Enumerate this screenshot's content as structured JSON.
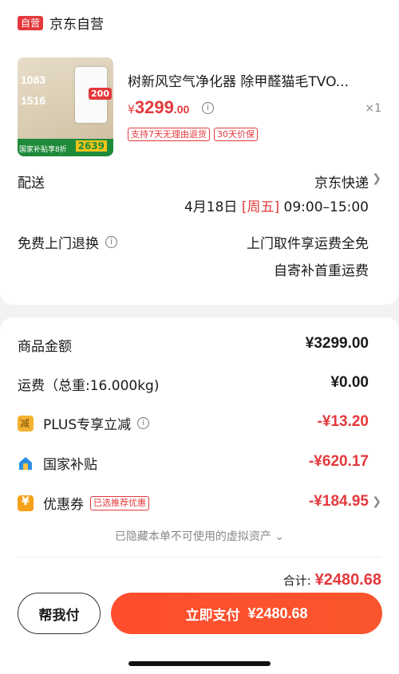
{
  "store": {
    "tag": "自营",
    "name": "京东自营"
  },
  "product": {
    "thumb": {
      "line1": "1083",
      "line2": "1516",
      "badge": "200",
      "bottom_text": "国家补贴享8折",
      "bottom_price": "2639"
    },
    "title": "树新风空气净化器 除甲醛猫毛TVO...",
    "price_yen": "¥",
    "price_int": "3299",
    "price_dec": ".00",
    "quantity": "×1",
    "tags": [
      "支持7天无理由退货",
      "30天价保"
    ]
  },
  "delivery": {
    "label": "配送",
    "carrier": "京东快递",
    "date": "4月18日",
    "weekday": "[周五]",
    "time": "09:00–15:00"
  },
  "return": {
    "label": "免费上门退换",
    "line1": "上门取件享运费全免",
    "line2": "自寄补首重运费"
  },
  "breakdown": {
    "goods_label": "商品金额",
    "goods_value": "¥3299.00",
    "shipping_label": "运费（总重:16.000kg)",
    "shipping_value": "¥0.00",
    "plus_label": "PLUS专享立减",
    "plus_value": "-¥13.20",
    "subsidy_label": "国家补贴",
    "subsidy_value": "-¥620.17",
    "coupon_label": "优惠券",
    "coupon_tag": "已选推荐优惠",
    "coupon_value": "-¥184.95"
  },
  "hidden_assets": "已隐藏本单不可使用的虚拟资产",
  "total": {
    "label": "合计:",
    "amount": "¥2480.68"
  },
  "footer": {
    "help_label": "帮我付",
    "pay_label": "立即支付",
    "pay_amount": "¥2480.68"
  },
  "colors": {
    "accent": "#e4393c",
    "pay_button": "#ff4d2e"
  }
}
